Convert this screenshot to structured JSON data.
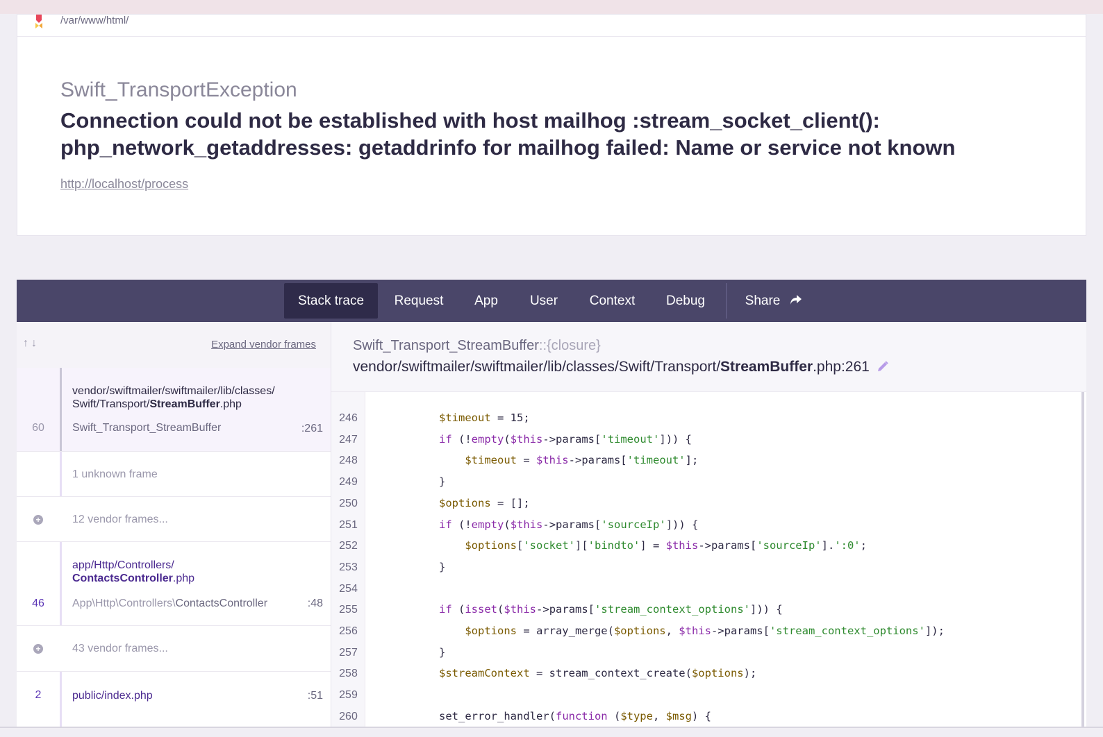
{
  "header": {
    "path": "/var/www/html/",
    "exception_class": "Swift_TransportException",
    "message": "Connection could not be established with host mailhog :stream_socket_client(): php_network_getaddresses: getaddrinfo for mailhog failed: Name or service not known",
    "url": "http://localhost/process"
  },
  "tabs": [
    {
      "label": "Stack trace"
    },
    {
      "label": "Request"
    },
    {
      "label": "App"
    },
    {
      "label": "User"
    },
    {
      "label": "Context"
    },
    {
      "label": "Debug"
    },
    {
      "label": "Share"
    }
  ],
  "left": {
    "arrows": "↑↓",
    "expand_label": "Expand vendor frames",
    "frames": [
      {
        "num": "60",
        "file_prefix": "vendor/swiftmailer/swiftmailer/lib/classes/",
        "file_prefix2": "Swift/Transport/",
        "file_bold": "StreamBuffer",
        "file_ext": ".php",
        "cls": "Swift_Transport_StreamBuffer",
        "line": ":261"
      },
      {
        "meta": "1 unknown frame"
      },
      {
        "plus": "+",
        "meta": "12 vendor frames..."
      },
      {
        "num": "46",
        "file_prefix": "app/Http/Controllers/",
        "file_bold": "ContactsController",
        "file_ext": ".php",
        "cls_prefix": "App\\Http\\Controllers\\",
        "cls": "ContactsController",
        "line": ":48"
      },
      {
        "plus": "+",
        "meta": "43 vendor frames..."
      },
      {
        "num": "2",
        "file_prefix": "public/",
        "file_bold": "index",
        "file_ext": ".php",
        "line": ":51"
      }
    ]
  },
  "right": {
    "class_name": "Swift_Transport_StreamBuffer",
    "closure": "::{closure}",
    "file_prefix": "vendor/swiftmailer/swiftmailer/lib/classes/Swift/Transport/",
    "file_bold": "StreamBuffer",
    "file_suffix": ".php:261",
    "code_lines": [
      {
        "n": "246",
        "text": "$timeout = 15;"
      },
      {
        "n": "247",
        "text": "if (!empty($this->params['timeout'])) {"
      },
      {
        "n": "248",
        "text": "    $timeout = $this->params['timeout'];"
      },
      {
        "n": "249",
        "text": "}"
      },
      {
        "n": "250",
        "text": "$options = [];"
      },
      {
        "n": "251",
        "text": "if (!empty($this->params['sourceIp'])) {"
      },
      {
        "n": "252",
        "text": "    $options['socket']['bindto'] = $this->params['sourceIp'].':0';"
      },
      {
        "n": "253",
        "text": "}"
      },
      {
        "n": "254",
        "text": ""
      },
      {
        "n": "255",
        "text": "if (isset($this->params['stream_context_options'])) {"
      },
      {
        "n": "256",
        "text": "    $options = array_merge($options, $this->params['stream_context_options']);"
      },
      {
        "n": "257",
        "text": "}"
      },
      {
        "n": "258",
        "text": "$streamContext = stream_context_create($options);"
      },
      {
        "n": "259",
        "text": ""
      },
      {
        "n": "260",
        "text": "set_error_handler(function ($type, $msg) {"
      }
    ]
  },
  "colors": {
    "tabbar": "#4a4669",
    "tab_active": "#2f2b4a",
    "app_frame": "#5b35b5",
    "code_var": "#7a5a00",
    "code_keyword": "#8a2aa8",
    "code_string": "#2e8a2e"
  }
}
